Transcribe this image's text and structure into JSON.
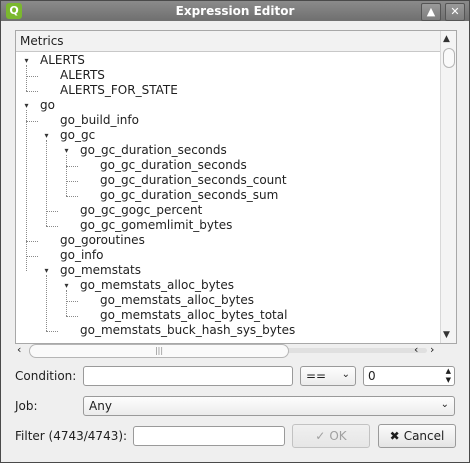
{
  "window": {
    "title": "Expression Editor",
    "app_icon": "Q",
    "titlebar_buttons": [
      "▲",
      "✕"
    ]
  },
  "tree": {
    "header": "Metrics",
    "nodes": [
      {
        "label": "ALERTS",
        "depth": 0,
        "expander": "expanded"
      },
      {
        "label": "ALERTS",
        "depth": 1,
        "expander": "none"
      },
      {
        "label": "ALERTS_FOR_STATE",
        "depth": 1,
        "expander": "none"
      },
      {
        "label": "go",
        "depth": 0,
        "expander": "expanded"
      },
      {
        "label": "go_build_info",
        "depth": 1,
        "expander": "none"
      },
      {
        "label": "go_gc",
        "depth": 1,
        "expander": "expanded"
      },
      {
        "label": "go_gc_duration_seconds",
        "depth": 2,
        "expander": "expanded"
      },
      {
        "label": "go_gc_duration_seconds",
        "depth": 3,
        "expander": "none"
      },
      {
        "label": "go_gc_duration_seconds_count",
        "depth": 3,
        "expander": "none"
      },
      {
        "label": "go_gc_duration_seconds_sum",
        "depth": 3,
        "expander": "none"
      },
      {
        "label": "go_gc_gogc_percent",
        "depth": 2,
        "expander": "none"
      },
      {
        "label": "go_gc_gomemlimit_bytes",
        "depth": 2,
        "expander": "none"
      },
      {
        "label": "go_goroutines",
        "depth": 1,
        "expander": "none"
      },
      {
        "label": "go_info",
        "depth": 1,
        "expander": "none"
      },
      {
        "label": "go_memstats",
        "depth": 1,
        "expander": "expanded"
      },
      {
        "label": "go_memstats_alloc_bytes",
        "depth": 2,
        "expander": "expanded"
      },
      {
        "label": "go_memstats_alloc_bytes",
        "depth": 3,
        "expander": "none"
      },
      {
        "label": "go_memstats_alloc_bytes_total",
        "depth": 3,
        "expander": "none"
      },
      {
        "label": "go_memstats_buck_hash_sys_bytes",
        "depth": 2,
        "expander": "none"
      }
    ]
  },
  "condition": {
    "label": "Condition:",
    "value": "",
    "operator": "==",
    "operand": "0"
  },
  "job": {
    "label": "Job:",
    "selected": "Any"
  },
  "filter": {
    "label": "Filter (4743/4743):",
    "value": ""
  },
  "buttons": {
    "ok": "OK",
    "cancel": "Cancel"
  },
  "icons": {
    "ok": "check-icon",
    "cancel": "cross-icon"
  }
}
